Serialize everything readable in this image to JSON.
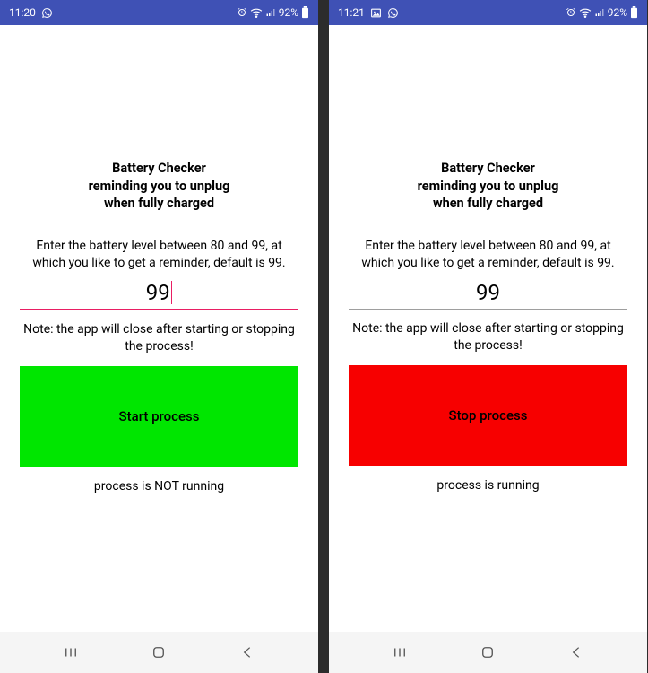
{
  "screens": [
    {
      "statusbar": {
        "time": "11:20",
        "left_icons": [
          "whatsapp"
        ],
        "right_icons": [
          "alarm",
          "wifi",
          "signal"
        ],
        "battery_pct": "92%"
      },
      "title_l1": "Battery Checker",
      "title_l2": "reminding you to unplug",
      "title_l3": "when fully charged",
      "instruction": "Enter the battery level between 80 and 99, at which you like to get a reminder, default is 99.",
      "input_value": "99",
      "input_focused": true,
      "note": "Note: the app will close after starting or stopping the process!",
      "button_label": "Start process",
      "button_color": "green",
      "status_text": "process is NOT running"
    },
    {
      "statusbar": {
        "time": "11:21",
        "left_icons": [
          "image",
          "whatsapp"
        ],
        "right_icons": [
          "alarm",
          "wifi",
          "signal"
        ],
        "battery_pct": "92%"
      },
      "title_l1": "Battery Checker",
      "title_l2": "reminding you to unplug",
      "title_l3": "when fully charged",
      "instruction": "Enter the battery level between 80 and 99, at which you like to get a reminder, default is 99.",
      "input_value": "99",
      "input_focused": false,
      "note": "Note: the app will close after starting or stopping the process!",
      "button_label": "Stop process",
      "button_color": "red",
      "status_text": "process is running"
    }
  ]
}
